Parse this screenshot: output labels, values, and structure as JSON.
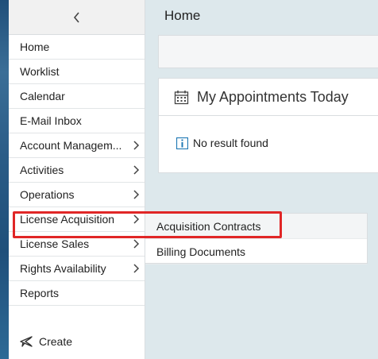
{
  "page": {
    "title": "Home"
  },
  "sidebar": {
    "collapse_icon": "chevron-left-icon",
    "items": [
      {
        "label": "Home",
        "has_children": false
      },
      {
        "label": "Worklist",
        "has_children": false
      },
      {
        "label": "Calendar",
        "has_children": false
      },
      {
        "label": "E-Mail Inbox",
        "has_children": false
      },
      {
        "label": "Account Managem...",
        "has_children": true
      },
      {
        "label": "Activities",
        "has_children": true
      },
      {
        "label": "Operations",
        "has_children": true
      },
      {
        "label": "License Acquisition",
        "has_children": true,
        "highlighted": true
      },
      {
        "label": "License Sales",
        "has_children": true
      },
      {
        "label": "Rights Availability",
        "has_children": true
      },
      {
        "label": "Reports",
        "has_children": false
      }
    ],
    "create": {
      "label": "Create",
      "icon": "airplane-icon"
    }
  },
  "appointments": {
    "title": "My Appointments Today",
    "icon": "calendar-icon",
    "empty_message": "No result found",
    "empty_icon": "info-icon"
  },
  "submenu": {
    "items": [
      {
        "label": "Acquisition Contracts"
      },
      {
        "label": "Billing Documents"
      }
    ]
  },
  "colors": {
    "highlight": "#e02626",
    "info_icon": "#1f78b4",
    "background": "#dde8ec"
  }
}
